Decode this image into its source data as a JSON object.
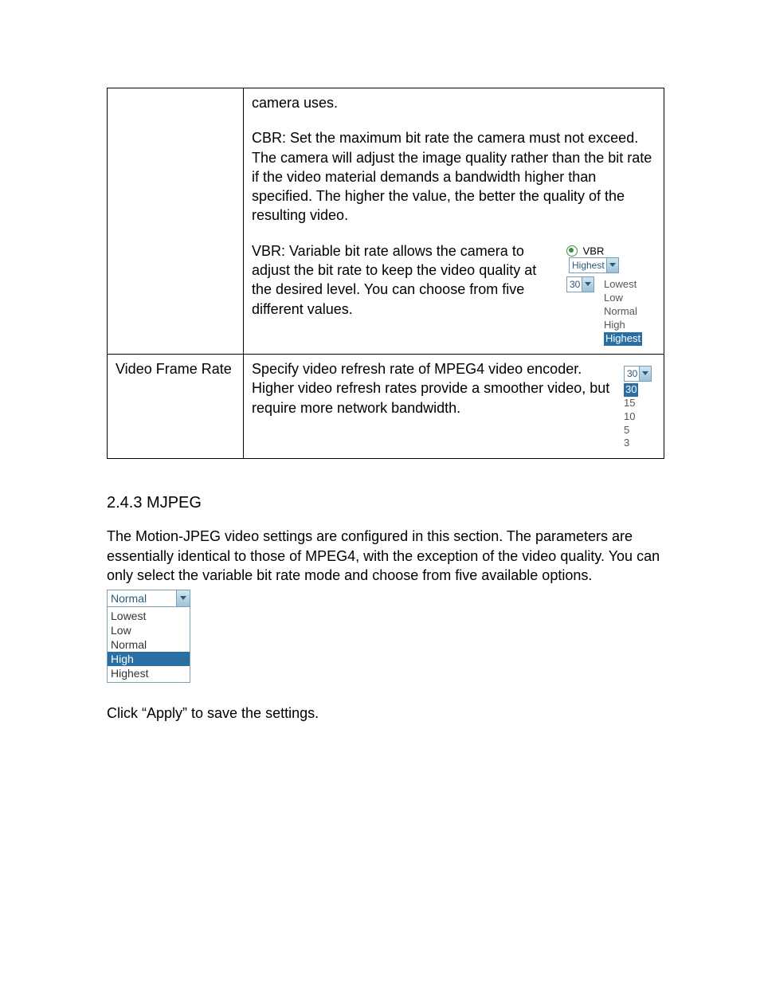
{
  "table": {
    "row0": {
      "left": "",
      "intro": "camera uses.",
      "cbr": "CBR: Set the maximum bit rate the camera must not exceed. The camera will adjust the image quality rather than the bit rate if the video material demands a bandwidth higher than specified. The higher the value, the better the quality of the resulting video.",
      "vbr_text": "VBR: Variable bit rate allows the camera to adjust the bit rate to keep the video quality at the desired level. You can choose from five different values.",
      "vbr_label": "VBR",
      "vbr_select_value": "Highest",
      "vbr_fps_value": "30",
      "vbr_options": [
        "Lowest",
        "Low",
        "Normal",
        "High",
        "Highest"
      ]
    },
    "row1": {
      "left": "Video Frame Rate",
      "text": "Specify video refresh rate of MPEG4 video encoder. Higher video refresh rates provide a smoother video, but require more network bandwidth.",
      "select_value": "30",
      "options": [
        "30",
        "15",
        "10",
        "5",
        "3"
      ]
    }
  },
  "section": {
    "heading": "2.4.3 MJPEG",
    "body": "The Motion-JPEG video settings are configured in this section. The parameters are essentially identical to those of MPEG4, with the exception of the video quality. You can only select the variable bit rate mode and choose from five available options.",
    "quality_value": "Normal",
    "quality_options": [
      "Lowest",
      "Low",
      "Normal",
      "High",
      "Highest"
    ],
    "apply_text": "Click “Apply” to save the settings."
  }
}
